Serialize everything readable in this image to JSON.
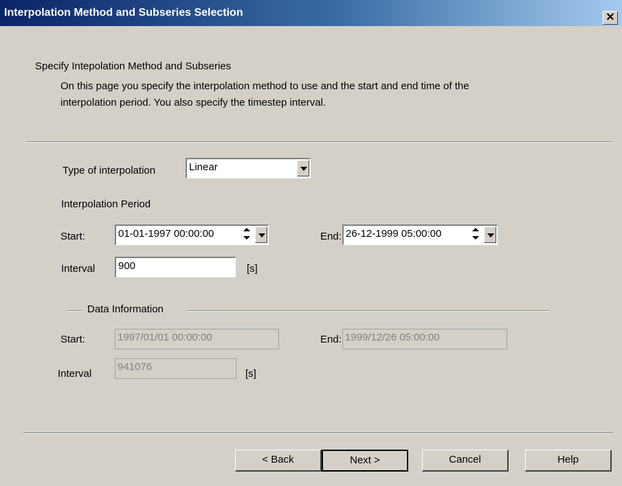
{
  "window": {
    "title": "Interpolation Method and Subseries Selection",
    "close_glyph": "✕"
  },
  "header": {
    "title": "Specify Intepolation Method and Subseries",
    "description_line1": "On this page you specify the interpolation method to use and the start and end time of the",
    "description_line2": "interpolation period. You also specify the timestep interval."
  },
  "interpolation": {
    "type_label": "Type of interpolation",
    "type_value": "Linear",
    "period_label": "Interpolation Period",
    "start_label": "Start:",
    "start_value": "01-01-1997 00:00:00",
    "end_label": "End:",
    "end_value": "26-12-1999 05:00:00",
    "interval_label": "Interval",
    "interval_value": "900",
    "interval_unit": "[s]"
  },
  "data_info": {
    "group_label": "Data Information",
    "start_label": "Start:",
    "start_value": "1997/01/01 00:00:00",
    "end_label": "End:",
    "end_value": "1999/12/26 05:00:00",
    "interval_label": "Interval",
    "interval_value": "941076",
    "interval_unit": "[s]"
  },
  "buttons": {
    "back": "< Back",
    "next": "Next >",
    "cancel": "Cancel",
    "help": "Help"
  },
  "colors": {
    "titlebar_start": "#0a246a",
    "titlebar_end": "#a6caf0",
    "dialog_bg": "#d4d0c8"
  }
}
